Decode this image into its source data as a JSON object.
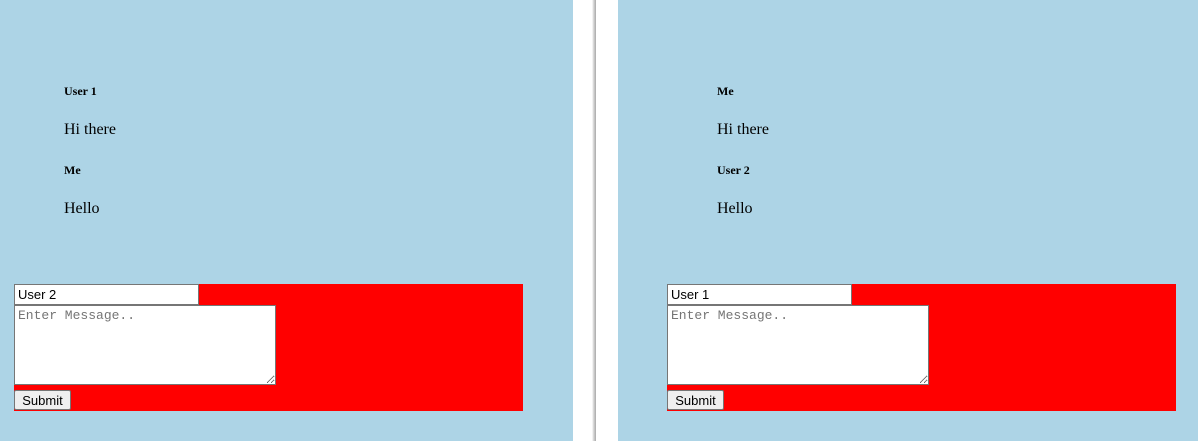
{
  "left_window": {
    "messages": [
      {
        "sender": "User 1",
        "text": "Hi there"
      },
      {
        "sender": "Me",
        "text": "Hello"
      }
    ],
    "form": {
      "username_value": "User 2",
      "message_placeholder": "Enter Message..",
      "submit_label": "Submit"
    }
  },
  "right_window": {
    "messages": [
      {
        "sender": "Me",
        "text": "Hi there"
      },
      {
        "sender": "User 2",
        "text": "Hello"
      }
    ],
    "form": {
      "username_value": "User 1",
      "message_placeholder": "Enter Message..",
      "submit_label": "Submit"
    }
  },
  "colors": {
    "panel_background": "#add4e6",
    "form_background": "#ff0000"
  }
}
